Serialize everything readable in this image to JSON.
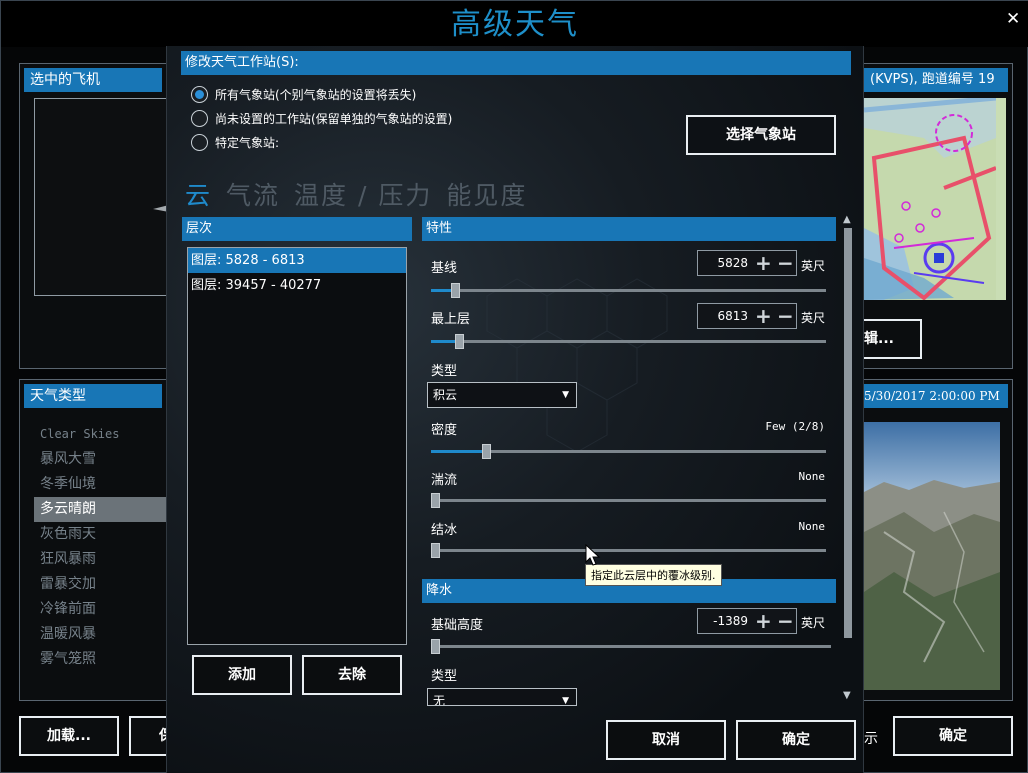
{
  "window": {
    "title": "高级天气",
    "close_glyph": "✕"
  },
  "left": {
    "aircraft_header": "选中的飞机",
    "weather_type_header": "天气类型",
    "weather_types": [
      {
        "label": "Clear Skies",
        "selected": false
      },
      {
        "label": "暴风大雪",
        "selected": false
      },
      {
        "label": "冬季仙境",
        "selected": false
      },
      {
        "label": "多云晴朗",
        "selected": true
      },
      {
        "label": "灰色雨天",
        "selected": false
      },
      {
        "label": "狂风暴雨",
        "selected": false
      },
      {
        "label": "雷暴交加",
        "selected": false
      },
      {
        "label": "冷锋前面",
        "selected": false
      },
      {
        "label": "温暖风暴",
        "selected": false
      },
      {
        "label": "雾气笼照",
        "selected": false
      }
    ],
    "load_button": "加载...",
    "partial_button": "保"
  },
  "right": {
    "airport_header": "(KVPS), 跑道编号 19",
    "edit_button_partial": "辑...",
    "datetime_header": "5/30/2017 2:00:00 PM",
    "partial_glyph": "示",
    "ok_button": "确定"
  },
  "dialog": {
    "station_header": "修改天气工作站(S):",
    "radio_options": [
      {
        "label": "所有气象站(个别气象站的设置将丢失)",
        "selected": true
      },
      {
        "label": "尚未设置的工作站(保留单独的气象站的设置)",
        "selected": false
      },
      {
        "label": "特定气象站:",
        "selected": false
      }
    ],
    "select_station_button": "选择气象站",
    "tabs": [
      {
        "label": "云",
        "active": true
      },
      {
        "label": "气流",
        "active": false
      },
      {
        "label": "温度 / 压力",
        "active": false
      },
      {
        "label": "能见度",
        "active": false
      }
    ],
    "layers_header": "层次",
    "layers": [
      {
        "label": "图层: 5828 - 6813",
        "selected": true
      },
      {
        "label": "图层: 39457 - 40277",
        "selected": false
      }
    ],
    "add_button": "添加",
    "remove_button": "去除",
    "properties_header": "特性",
    "properties": {
      "base_label": "基线",
      "base_value": "5828",
      "base_unit": "英尺",
      "base_slider": 0.06,
      "top_label": "最上层",
      "top_value": "6813",
      "top_unit": "英尺",
      "top_slider": 0.07,
      "type_label": "类型",
      "type_value": "积云",
      "density_label": "密度",
      "density_value": "Few (2/8)",
      "density_slider": 0.14,
      "turbulence_label": "湍流",
      "turbulence_value": "None",
      "icing_label": "结冰",
      "icing_value": "None"
    },
    "tooltip": "指定此云层中的覆冰级别.",
    "precip_header": "降水",
    "precip": {
      "base_height_label": "基础高度",
      "base_height_value": "-1389",
      "base_height_unit": "英尺",
      "type_label": "类型",
      "type_value": "无"
    },
    "cancel_button": "取消",
    "ok_button": "确定"
  },
  "colors": {
    "accent": "#1876b6",
    "title_blue": "#1e8fc9"
  }
}
